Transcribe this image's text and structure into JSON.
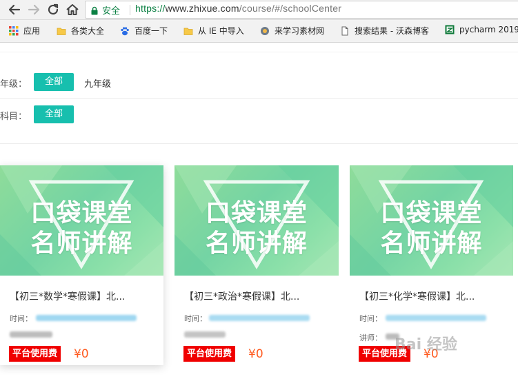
{
  "browser": {
    "secure_label": "安全",
    "url_scheme": "https://",
    "url_host": "www.zhixue.com",
    "url_path": "/course/#/schoolCenter"
  },
  "bookmarks": [
    {
      "label": "应用",
      "icon": "apps-grid-icon"
    },
    {
      "label": "各类大全",
      "icon": "folder-icon"
    },
    {
      "label": "百度一下",
      "icon": "baidu-paw-icon"
    },
    {
      "label": "从 IE 中导入",
      "icon": "folder-icon"
    },
    {
      "label": "来学习素材网",
      "icon": "site-favicon-icon"
    },
    {
      "label": "搜索结果 - 沃森博客",
      "icon": "page-icon"
    },
    {
      "label": "pycharm 2019",
      "icon": "pycharm-icon"
    }
  ],
  "filters": {
    "grade": {
      "label": "年级：",
      "selected": "全部",
      "option": "九年级"
    },
    "subject": {
      "label": "科目：",
      "selected": "全部"
    }
  },
  "thumbnail": {
    "line1": "口袋课堂",
    "line2": "名师讲解"
  },
  "courses": [
    {
      "title": "【初三*数学*寒假课】北...",
      "time_label": "时间：",
      "fee_label": "平台使用费",
      "price": "¥0"
    },
    {
      "title": "【初三*政治*寒假课】北...",
      "time_label": "时间：",
      "fee_label": "平台使用费",
      "price": "¥0"
    },
    {
      "title": "【初三*化学*寒假课】北...",
      "time_label": "时间：",
      "teacher_label": "讲师：",
      "fee_label": "平台使用费",
      "price": "¥0"
    }
  ],
  "watermark": "Bai 经验",
  "colors": {
    "accent_teal": "#17bfae",
    "fee_red": "#f00000",
    "price_orange": "#ff5a1f",
    "secure_green": "#0b8043"
  }
}
